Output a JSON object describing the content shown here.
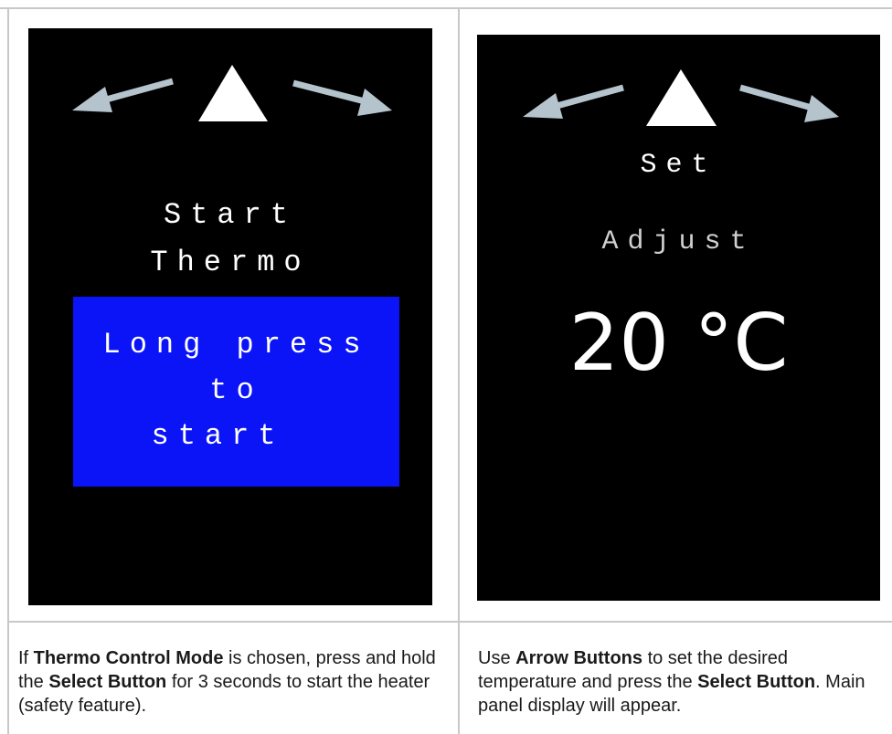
{
  "screen_left": {
    "title_line1": "Start",
    "title_line2": "Thermo",
    "box_line1": "Long press",
    "box_line2": "to",
    "box_line3": "start",
    "box_color": "#0a14f6",
    "icons": [
      "arrow-left-icon",
      "triangle-up-icon",
      "arrow-right-icon"
    ]
  },
  "screen_right": {
    "label_set": "Set",
    "label_adjust": "Adjust",
    "temperature": "20 °C",
    "icons": [
      "arrow-left-icon",
      "triangle-up-icon",
      "arrow-right-icon"
    ]
  },
  "captions": {
    "left": {
      "part1": "If ",
      "bold1": "Thermo Control Mode",
      "part2": " is chosen, press and hold the ",
      "bold2": "Select Button",
      "part3": " for 3 seconds to start the heater (safety feature)."
    },
    "right": {
      "part1": "Use ",
      "bold1": "Arrow Buttons",
      "part2": " to set the desired temperature and press the ",
      "bold2": "Select Button",
      "part3": ". Main panel display will appear."
    }
  },
  "colors": {
    "screen_bg": "#000000",
    "arrow_gray": "#b4c3cc",
    "text_white": "#ffffff",
    "border": "#c8c8c8"
  }
}
